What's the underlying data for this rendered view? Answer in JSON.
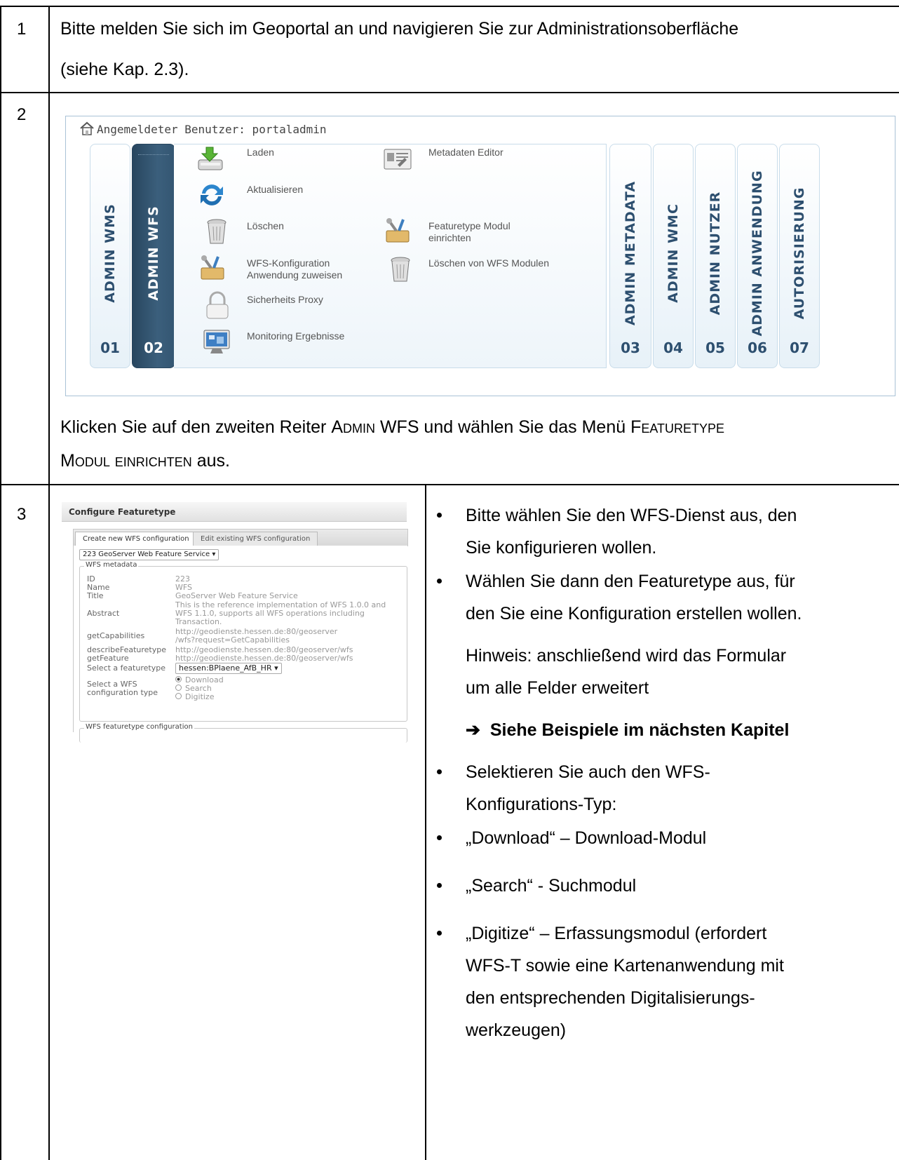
{
  "rows": {
    "r1": {
      "number": "1",
      "line1": "Bitte melden Sie sich im Geoportal an und navigieren Sie zur Administrationsoberfläche",
      "line2": "(siehe Kap. 2.3)."
    },
    "r2": {
      "number": "2",
      "user_label": "Angemeldeter Benutzer: portaladmin",
      "tabs": [
        {
          "label": "ADMIN WMS",
          "number": "01"
        },
        {
          "label": "ADMIN WFS",
          "number": "02"
        },
        {
          "label": "ADMIN METADATA",
          "number": "03"
        },
        {
          "label": "ADMIN WMC",
          "number": "04"
        },
        {
          "label": "ADMIN NUTZER",
          "number": "05"
        },
        {
          "label": "ADMIN ANWENDUNG",
          "number": "06"
        },
        {
          "label": "AUTORISIERUNG",
          "number": "07"
        }
      ],
      "menu": {
        "laden": "Laden",
        "aktualisieren": "Aktualisieren",
        "loeschen": "Löschen",
        "wfs_konf_1": "WFS-Konfiguration",
        "wfs_konf_2": "Anwendung zuweisen",
        "sicherheit": "Sicherheits Proxy",
        "monitoring": "Monitoring Ergebnisse",
        "metadaten": "Metadaten Editor",
        "featuretype_1": "Featuretype Modul",
        "featuretype_2": "einrichten",
        "loeschen_wfs": "Löschen von WFS Modulen"
      },
      "instr_a": "Klicken Sie auf den zweiten Reiter ",
      "instr_b": "Admin",
      "instr_c": " WFS und wählen Sie das Menü ",
      "instr_d": "Featuretype",
      "instr_e": "Modul einrichten",
      "instr_f": " aus."
    },
    "r3": {
      "number": "3",
      "screenshot": {
        "title": "Configure Featuretype",
        "tab_new": "Create new WFS configuration",
        "tab_edit": "Edit existing WFS configuration",
        "service_select": "223 GeoServer Web Feature Service",
        "legend_metadata": "WFS metadata",
        "k_id": "ID",
        "v_id": "223",
        "k_name": "Name",
        "v_name": "WFS",
        "k_title": "Title",
        "v_title": "GeoServer Web Feature Service",
        "k_abstract": "Abstract",
        "v_abstract_1": "This is the reference implementation of WFS 1.0.0 and",
        "v_abstract_2": "WFS 1.1.0, supports all WFS operations including",
        "v_abstract_3": "Transaction.",
        "k_getcap": "getCapabilities",
        "v_getcap_1": "http://geodienste.hessen.de:80/geoserver",
        "v_getcap_2": "/wfs?request=GetCapabilities",
        "k_describe": "describeFeaturetype",
        "v_describe": "http://geodienste.hessen.de:80/geoserver/wfs",
        "k_getfeature": "getFeature",
        "v_getfeature": "http://geodienste.hessen.de:80/geoserver/wfs",
        "k_select_ft": "Select a featuretype",
        "v_select_ft": "hessen:BPlaene_AfB_HR",
        "k_select_type_1": "Select a WFS",
        "k_select_type_2": "configuration type",
        "opt_download": "Download",
        "opt_search": "Search",
        "opt_digitize": "Digitize",
        "legend_ft": "WFS featuretype configuration"
      },
      "b1_l1": "Bitte wählen Sie den WFS-Dienst aus, den",
      "b1_l2": "Sie konfigurieren wollen.",
      "b2_l1": "Wählen Sie dann den Featuretype aus, für",
      "b2_l2": "den Sie eine Konfiguration erstellen wollen.",
      "hint_l1": "Hinweis: anschließend wird das Formular",
      "hint_l2": "um alle Felder erweitert",
      "arrow": "➔",
      "see_examples": "Siehe Beispiele im nächsten Kapitel",
      "b3_l1": "Selektieren Sie auch den WFS-",
      "b3_l2": "Konfigurations-Typ:",
      "b4": "„Download“ – Download-Modul",
      "b5": "„Search“ - Suchmodul",
      "b6_l1": "„Digitize“ – Erfassungsmodul (erfordert",
      "b6_l2": "WFS-T sowie eine Kartenanwendung mit",
      "b6_l3": "den entsprechenden Digitalisierungs-",
      "b6_l4": "werkzeugen)"
    }
  }
}
